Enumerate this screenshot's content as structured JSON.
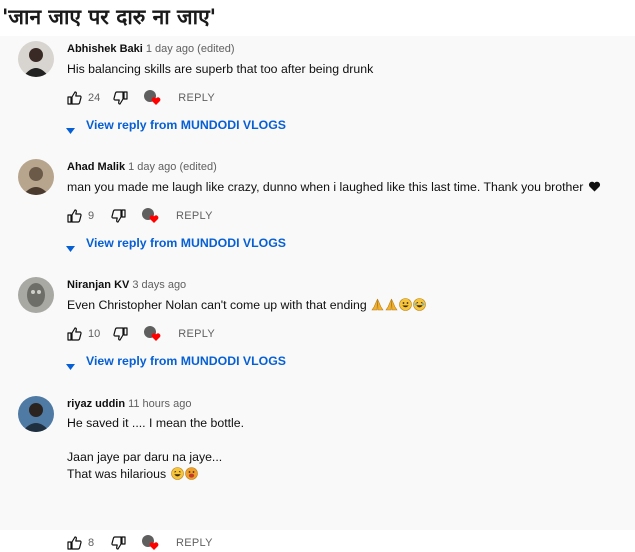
{
  "headline": "'जान जाए पर दारु ना जाए'",
  "comments": [
    {
      "author": "Abhishek Baki",
      "time": "1 day ago (edited)",
      "text": "His balancing skills are superb that too after being drunk",
      "likes": "24",
      "reply_label": "REPLY",
      "view_reply": "View reply from MUNDODI VLOGS",
      "avatar_color": "#3a2a25"
    },
    {
      "author": "Ahad Malik",
      "time": "1 day ago (edited)",
      "text": "man you made me laugh like crazy, dunno when i laughed like this last time. Thank you brother",
      "likes": "9",
      "reply_label": "REPLY",
      "view_reply": "View reply from MUNDODI VLOGS",
      "avatar_color": "#6b5a48"
    },
    {
      "author": "Niranjan KV",
      "time": "3 days ago",
      "text": "Even Christopher Nolan can't come up with that ending",
      "likes": "10",
      "reply_label": "REPLY",
      "view_reply": "View reply from MUNDODI VLOGS",
      "avatar_color": "#8a8a86"
    },
    {
      "author": "riyaz uddin",
      "time": "11 hours ago",
      "text_lines": [
        "He saved it .... I mean the bottle.",
        "",
        "Jaan jaye par daru na jaye...",
        "That was hilarious"
      ],
      "likes": "8",
      "reply_label": "REPLY",
      "avatar_color": "#2f4a63"
    }
  ],
  "colors": {
    "link_blue": "#065fd4",
    "heart_red": "#ff0000",
    "secondary_text": "#606060"
  },
  "icons": [
    "thumbs-up-icon",
    "thumbs-down-icon",
    "creator-heart-icon",
    "expand-triangle-icon",
    "black-heart-emoji",
    "folded-hands-emoji",
    "grinning-face-emoji",
    "laughing-face-emoji"
  ]
}
